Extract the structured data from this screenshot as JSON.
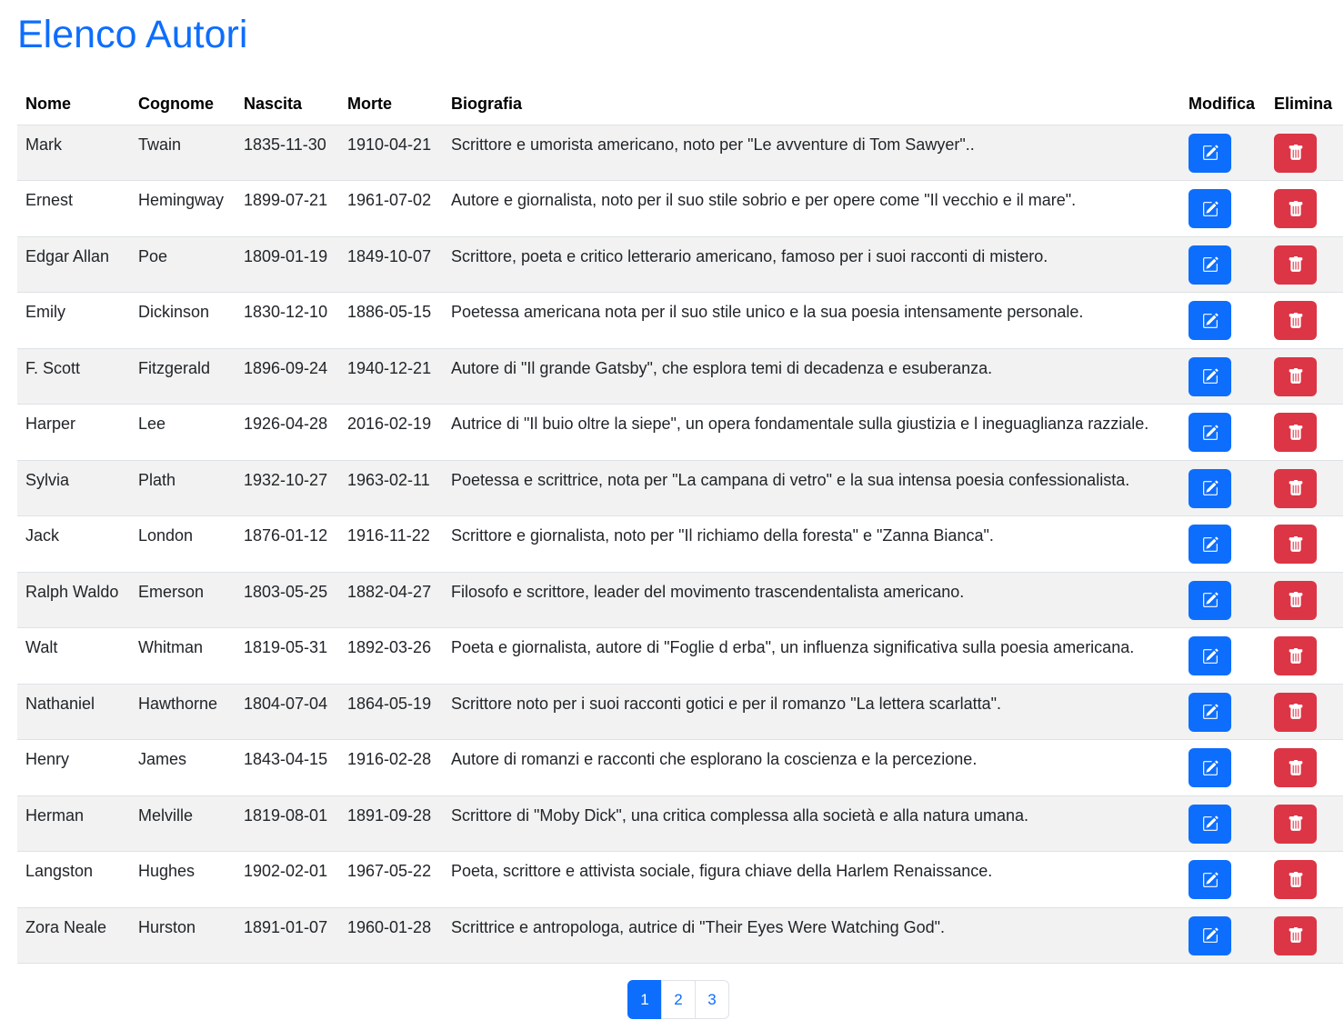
{
  "title": "Elenco Autori",
  "columns": {
    "nome": "Nome",
    "cognome": "Cognome",
    "nascita": "Nascita",
    "morte": "Morte",
    "biografia": "Biografia",
    "modifica": "Modifica",
    "elimina": "Elimina"
  },
  "rows": [
    {
      "nome": "Mark",
      "cognome": "Twain",
      "nascita": "1835-11-30",
      "morte": "1910-04-21",
      "biografia": "Scrittore e umorista americano, noto per \"Le avventure di Tom Sawyer\".."
    },
    {
      "nome": "Ernest",
      "cognome": "Hemingway",
      "nascita": "1899-07-21",
      "morte": "1961-07-02",
      "biografia": "Autore e giornalista, noto per il suo stile sobrio e per opere come \"Il vecchio e il mare\"."
    },
    {
      "nome": "Edgar Allan",
      "cognome": "Poe",
      "nascita": "1809-01-19",
      "morte": "1849-10-07",
      "biografia": "Scrittore, poeta e critico letterario americano, famoso per i suoi racconti di mistero."
    },
    {
      "nome": "Emily",
      "cognome": "Dickinson",
      "nascita": "1830-12-10",
      "morte": "1886-05-15",
      "biografia": "Poetessa americana nota per il suo stile unico e la sua poesia intensamente personale."
    },
    {
      "nome": "F. Scott",
      "cognome": "Fitzgerald",
      "nascita": "1896-09-24",
      "morte": "1940-12-21",
      "biografia": "Autore di \"Il grande Gatsby\", che esplora temi di decadenza e esuberanza."
    },
    {
      "nome": "Harper",
      "cognome": "Lee",
      "nascita": "1926-04-28",
      "morte": "2016-02-19",
      "biografia": "Autrice di \"Il buio oltre la siepe\", un opera fondamentale sulla giustizia e l ineguaglianza razziale."
    },
    {
      "nome": "Sylvia",
      "cognome": "Plath",
      "nascita": "1932-10-27",
      "morte": "1963-02-11",
      "biografia": "Poetessa e scrittrice, nota per \"La campana di vetro\" e la sua intensa poesia confessionalista."
    },
    {
      "nome": "Jack",
      "cognome": "London",
      "nascita": "1876-01-12",
      "morte": "1916-11-22",
      "biografia": "Scrittore e giornalista, noto per \"Il richiamo della foresta\" e \"Zanna Bianca\"."
    },
    {
      "nome": "Ralph Waldo",
      "cognome": "Emerson",
      "nascita": "1803-05-25",
      "morte": "1882-04-27",
      "biografia": "Filosofo e scrittore, leader del movimento trascendentalista americano."
    },
    {
      "nome": "Walt",
      "cognome": "Whitman",
      "nascita": "1819-05-31",
      "morte": "1892-03-26",
      "biografia": "Poeta e giornalista, autore di \"Foglie d erba\", un influenza significativa sulla poesia americana."
    },
    {
      "nome": "Nathaniel",
      "cognome": "Hawthorne",
      "nascita": "1804-07-04",
      "morte": "1864-05-19",
      "biografia": "Scrittore noto per i suoi racconti gotici e per il romanzo \"La lettera scarlatta\"."
    },
    {
      "nome": "Henry",
      "cognome": "James",
      "nascita": "1843-04-15",
      "morte": "1916-02-28",
      "biografia": "Autore di romanzi e racconti che esplorano la coscienza e la percezione."
    },
    {
      "nome": "Herman",
      "cognome": "Melville",
      "nascita": "1819-08-01",
      "morte": "1891-09-28",
      "biografia": "Scrittore di \"Moby Dick\", una critica complessa alla società e alla natura umana."
    },
    {
      "nome": "Langston",
      "cognome": "Hughes",
      "nascita": "1902-02-01",
      "morte": "1967-05-22",
      "biografia": "Poeta, scrittore e attivista sociale, figura chiave della Harlem Renaissance."
    },
    {
      "nome": "Zora Neale",
      "cognome": "Hurston",
      "nascita": "1891-01-07",
      "morte": "1960-01-28",
      "biografia": "Scrittrice e antropologa, autrice di \"Their Eyes Were Watching God\"."
    }
  ],
  "actions": {
    "edit_icon": "pencil-square-icon",
    "delete_icon": "trash-icon"
  },
  "pagination": {
    "pages": [
      "1",
      "2",
      "3"
    ],
    "active": "1"
  },
  "colors": {
    "primary": "#0d6efd",
    "danger": "#dc3545",
    "stripe": "#f2f2f2"
  }
}
